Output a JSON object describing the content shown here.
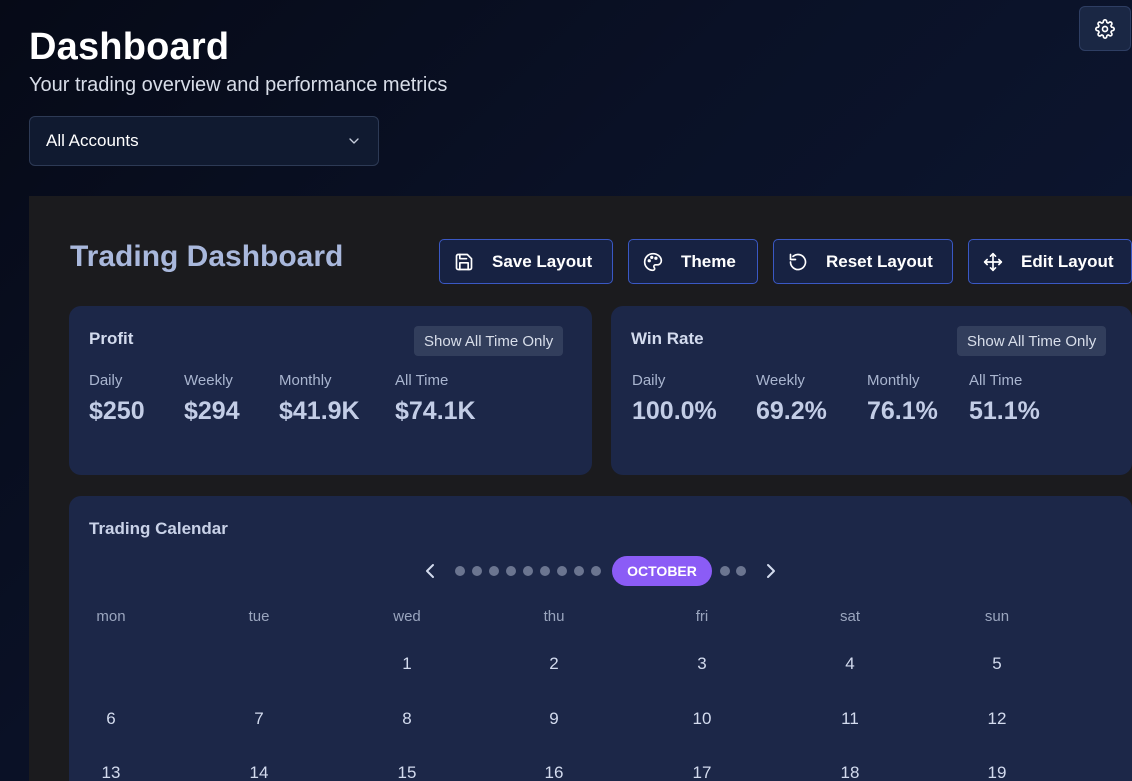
{
  "header": {
    "title": "Dashboard",
    "subtitle": "Your trading overview and performance metrics",
    "settings_icon": "gear-icon"
  },
  "account_select": {
    "value": "All Accounts"
  },
  "panel": {
    "title": "Trading Dashboard",
    "toolbar": {
      "save_label": "Save Layout",
      "theme_label": "Theme",
      "reset_label": "Reset Layout",
      "edit_label": "Edit Layout"
    }
  },
  "profit": {
    "title": "Profit",
    "toggle": "Show All Time Only",
    "metrics": [
      {
        "label": "Daily",
        "value": "$250"
      },
      {
        "label": "Weekly",
        "value": "$294"
      },
      {
        "label": "Monthly",
        "value": "$41.9K"
      },
      {
        "label": "All Time",
        "value": "$74.1K"
      }
    ]
  },
  "winrate": {
    "title": "Win Rate",
    "toggle": "Show All Time Only",
    "metrics": [
      {
        "label": "Daily",
        "value": "100.0%"
      },
      {
        "label": "Weekly",
        "value": "69.2%"
      },
      {
        "label": "Monthly",
        "value": "76.1%"
      },
      {
        "label": "All Time",
        "value": "51.1%"
      }
    ]
  },
  "calendar": {
    "title": "Trading Calendar",
    "month": "OCTOBER",
    "weekdays": [
      "mon",
      "tue",
      "wed",
      "thu",
      "fri",
      "sat",
      "sun"
    ],
    "weeks": [
      [
        "",
        "",
        "1",
        "2",
        "3",
        "4",
        "5"
      ],
      [
        "6",
        "7",
        "8",
        "9",
        "10",
        "11",
        "12"
      ],
      [
        "13",
        "14",
        "15",
        "16",
        "17",
        "18",
        "19"
      ]
    ]
  },
  "colors": {
    "accent": "#8b5cf6",
    "button_border": "#3a58c4",
    "card_bg": "#1c2748",
    "panel_bg": "#1b1b1e"
  }
}
